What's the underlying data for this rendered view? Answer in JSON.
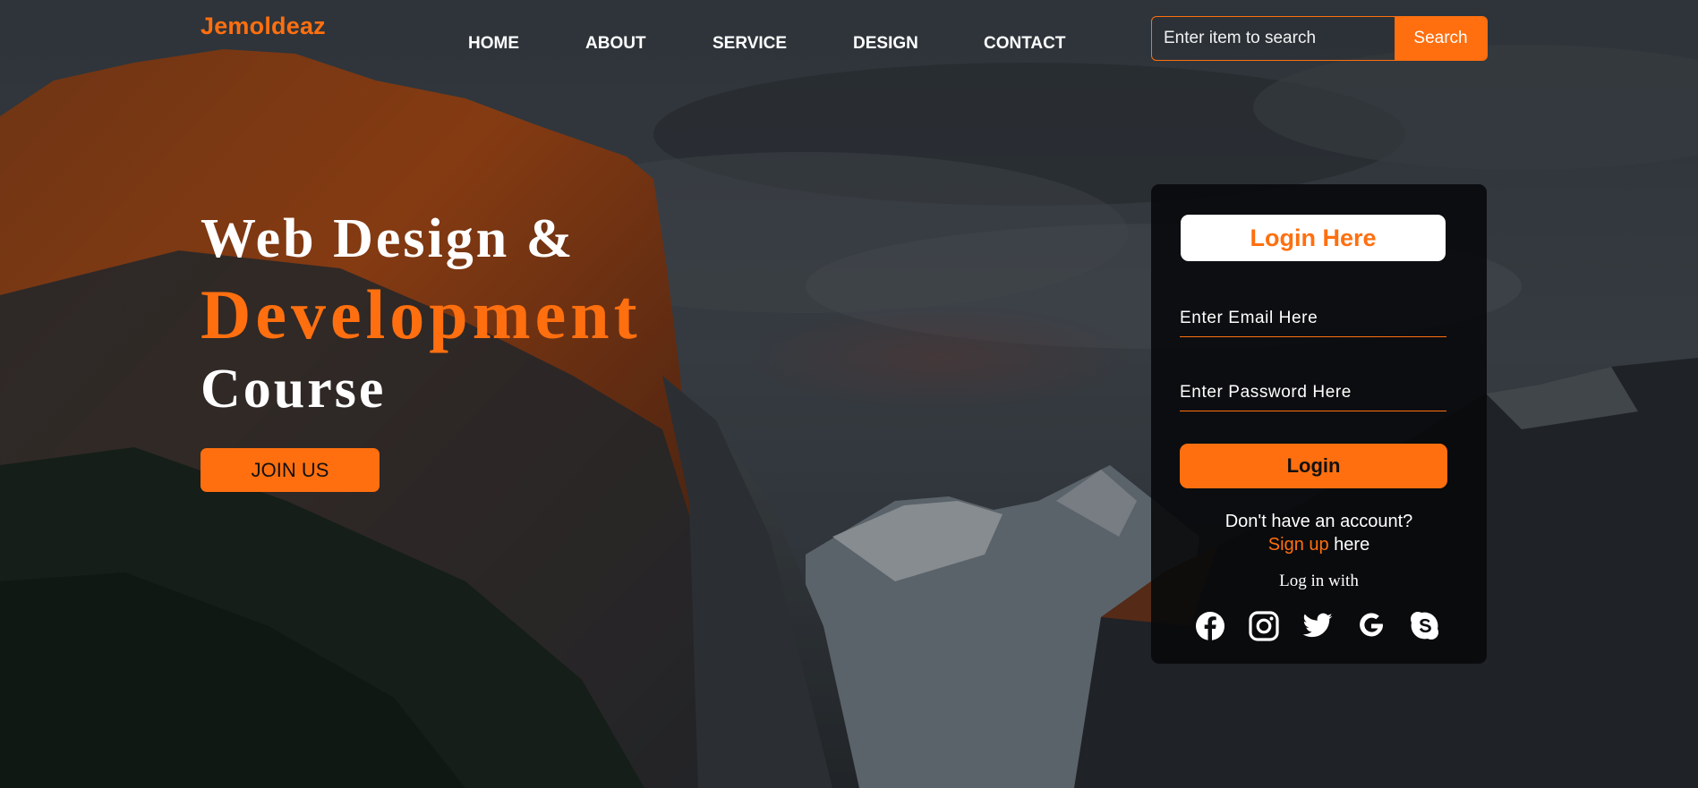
{
  "brand": {
    "logo": "Jemoldeaz",
    "accent_color": "#ff6f0f"
  },
  "nav": {
    "items": [
      {
        "label": "HOME"
      },
      {
        "label": "ABOUT"
      },
      {
        "label": "SERVICE"
      },
      {
        "label": "DESIGN"
      },
      {
        "label": "CONTACT"
      }
    ]
  },
  "search": {
    "placeholder": "Enter item to search",
    "button": "Search"
  },
  "hero": {
    "line1": "Web Design &",
    "line2": "Development",
    "line3": "Course",
    "cta": "JOIN US"
  },
  "login": {
    "title": "Login Here",
    "email_placeholder": "Enter Email Here",
    "password_placeholder": "Enter Password Here",
    "button": "Login",
    "no_account": "Don't have an account?",
    "signup_link": "Sign up",
    "signup_suffix": " here",
    "login_with": "Log in with",
    "socials": [
      "facebook-icon",
      "instagram-icon",
      "twitter-icon",
      "google-icon",
      "skype-icon"
    ]
  }
}
